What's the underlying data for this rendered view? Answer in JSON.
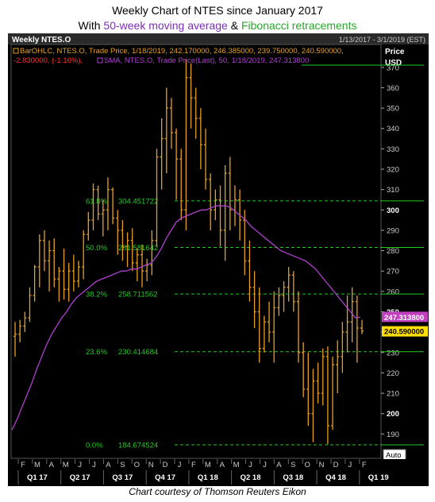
{
  "header": {
    "title": "Weekly Chart of NTES since January 2017",
    "subtitle_prefix": "With ",
    "subtitle_ma": "50-week moving average",
    "subtitle_and": " & ",
    "subtitle_fib": "Fibonacci retracements"
  },
  "caption": "Chart courtesy of Thomson Reuters Eikon",
  "colors": {
    "bar": "#e8a020",
    "sma": "#b040d0",
    "fib": "#22cc22",
    "price_badge_sma": "#c040c0",
    "price_badge_last": "#ffe000",
    "title_purple": "#7b2fb5",
    "title_green": "#27a827"
  },
  "chart_data": {
    "type": "ohlc",
    "panel_title": "Weekly NTES.O",
    "date_range": "1/13/2017 - 3/1/2019 (EST)",
    "legend_bar": "BarOHLC, NTES.O, Trade Price, 1/18/2019, 242.170000, 246.385000, 239.750000, 240.590000,",
    "legend_bar_change": "-2.830000, (-1.16%),",
    "legend_sma": "SMA, NTES.O, Trade Price(Last), 50, 1/18/2019, 247.313800",
    "y_axis_title": "Price",
    "y_axis_unit": "USD",
    "ylim": [
      180,
      375
    ],
    "y_ticks": [
      190,
      200,
      210,
      220,
      230,
      240,
      250,
      260,
      270,
      280,
      290,
      300,
      310,
      320,
      330,
      340,
      350,
      360,
      370
    ],
    "y_ticks_bold": [
      200,
      250,
      300
    ],
    "sma_badge": "247.313800",
    "last_badge": "240.590000",
    "auto_label": "Auto",
    "x_months": [
      "F",
      "M",
      "A",
      "M",
      "J",
      "J",
      "A",
      "S",
      "O",
      "N",
      "D",
      "J",
      "F",
      "M",
      "A",
      "M",
      "J",
      "J",
      "A",
      "S",
      "O",
      "N",
      "D",
      "J",
      "F"
    ],
    "x_quarters": [
      "Q1 17",
      "Q2 17",
      "Q3 17",
      "Q4 17",
      "Q1 18",
      "Q2 18",
      "Q3 18",
      "Q4 18",
      "Q1 19"
    ],
    "fib_levels": [
      {
        "label": "61.8%",
        "value": 304.451722,
        "text": "304.451722"
      },
      {
        "label": "50.0%",
        "value": 281.581642,
        "text": "281.581642"
      },
      {
        "label": "38.2%",
        "value": 258.711562,
        "text": "258.711562"
      },
      {
        "label": "23.6%",
        "value": 230.414684,
        "text": "230.414684"
      },
      {
        "label": "0.0%",
        "value": 184.674524,
        "text": "184.674524"
      }
    ],
    "sma_values": [
      192,
      197,
      203,
      209,
      215,
      222,
      228,
      234,
      239,
      243,
      247,
      250,
      254,
      257,
      259,
      261,
      263,
      265,
      266,
      267,
      268,
      269,
      270,
      270,
      271,
      271,
      272,
      273,
      274,
      277,
      281,
      286,
      290,
      294,
      296,
      297,
      298,
      299,
      300,
      300,
      301,
      302,
      302,
      302,
      301,
      299,
      297,
      295,
      292,
      290,
      288,
      286,
      284,
      282,
      280,
      279,
      278,
      277,
      276,
      275,
      273,
      271,
      268,
      265,
      262,
      259,
      256,
      253,
      250,
      247,
      247.3
    ],
    "bars": [
      [
        238,
        228,
        245,
        239
      ],
      [
        239,
        235,
        246,
        243
      ],
      [
        243,
        240,
        250,
        247
      ],
      [
        247,
        245,
        262,
        258
      ],
      [
        258,
        255,
        273,
        272
      ],
      [
        272,
        262,
        288,
        285
      ],
      [
        285,
        270,
        290,
        275
      ],
      [
        275,
        260,
        285,
        280
      ],
      [
        280,
        262,
        286,
        266
      ],
      [
        266,
        255,
        272,
        270
      ],
      [
        270,
        256,
        281,
        261
      ],
      [
        261,
        255,
        274,
        270
      ],
      [
        270,
        260,
        278,
        265
      ],
      [
        265,
        262,
        275,
        272
      ],
      [
        272,
        266,
        290,
        288
      ],
      [
        288,
        285,
        299,
        295
      ],
      [
        295,
        290,
        313,
        310
      ],
      [
        310,
        295,
        312,
        298
      ],
      [
        298,
        287,
        305,
        300
      ],
      [
        300,
        290,
        316,
        310
      ],
      [
        310,
        293,
        311,
        296
      ],
      [
        296,
        278,
        300,
        290
      ],
      [
        290,
        275,
        295,
        282
      ],
      [
        282,
        272,
        289,
        285
      ],
      [
        285,
        270,
        291,
        274
      ],
      [
        274,
        265,
        281,
        278
      ],
      [
        278,
        262,
        283,
        270
      ],
      [
        270,
        265,
        276,
        273
      ],
      [
        273,
        268,
        290,
        285
      ],
      [
        285,
        282,
        330,
        326
      ],
      [
        326,
        310,
        345,
        335
      ],
      [
        335,
        318,
        360,
        350
      ],
      [
        350,
        330,
        355,
        338
      ],
      [
        338,
        305,
        340,
        325
      ],
      [
        325,
        295,
        330,
        300
      ],
      [
        300,
        290,
        374,
        365
      ],
      [
        365,
        340,
        372,
        355
      ],
      [
        355,
        335,
        360,
        345
      ],
      [
        345,
        320,
        350,
        332
      ],
      [
        332,
        310,
        340,
        315
      ],
      [
        315,
        290,
        318,
        300
      ],
      [
        300,
        295,
        310,
        305
      ],
      [
        305,
        282,
        312,
        290
      ],
      [
        290,
        275,
        322,
        318
      ],
      [
        318,
        290,
        326,
        300
      ],
      [
        300,
        292,
        312,
        305
      ],
      [
        305,
        285,
        310,
        295
      ],
      [
        295,
        268,
        300,
        275
      ],
      [
        275,
        255,
        285,
        262
      ],
      [
        262,
        242,
        270,
        250
      ],
      [
        250,
        225,
        262,
        232
      ],
      [
        232,
        230,
        248,
        245
      ],
      [
        245,
        235,
        255,
        240
      ],
      [
        240,
        225,
        260,
        252
      ],
      [
        252,
        248,
        262,
        258
      ],
      [
        258,
        250,
        265,
        262
      ],
      [
        262,
        255,
        272,
        268
      ],
      [
        268,
        250,
        270,
        255
      ],
      [
        255,
        225,
        260,
        230
      ],
      [
        230,
        208,
        235,
        212
      ],
      [
        212,
        194,
        230,
        200
      ],
      [
        200,
        186,
        222,
        216
      ],
      [
        216,
        205,
        225,
        210
      ],
      [
        210,
        204,
        232,
        228
      ],
      [
        228,
        185,
        233,
        194
      ],
      [
        194,
        192,
        228,
        224
      ],
      [
        224,
        210,
        236,
        228
      ],
      [
        228,
        220,
        245,
        240
      ],
      [
        240,
        230,
        258,
        245
      ],
      [
        245,
        235,
        262,
        255
      ],
      [
        255,
        225,
        258,
        242
      ],
      [
        242,
        239,
        246,
        240.59
      ]
    ]
  }
}
